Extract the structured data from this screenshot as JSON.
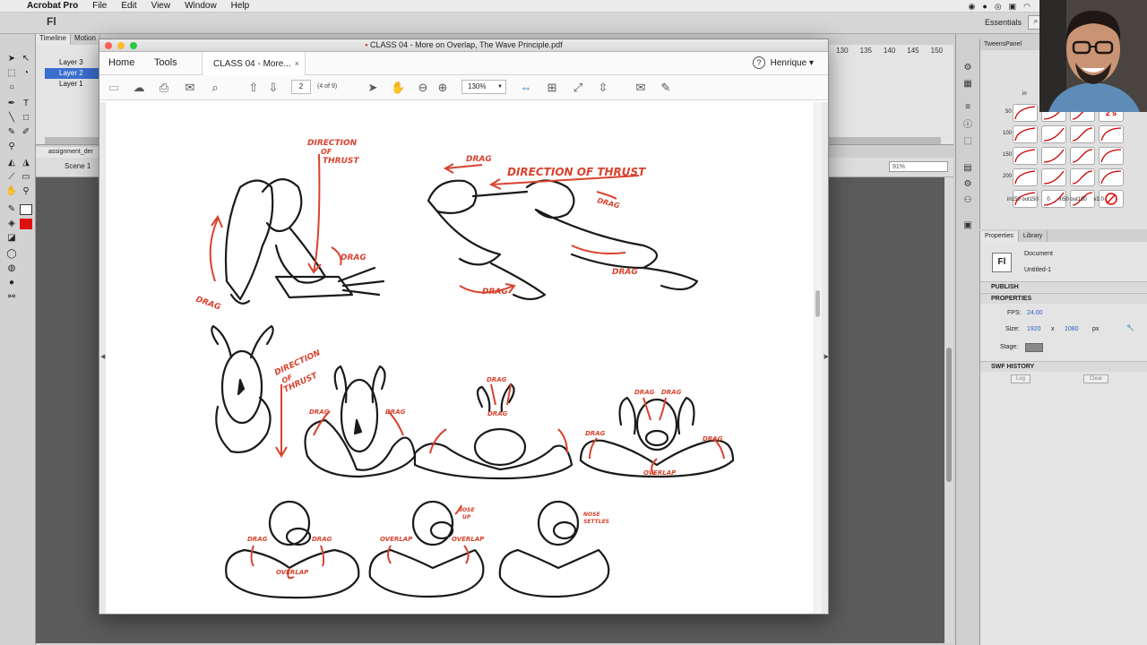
{
  "menubar": {
    "app_name": "Acrobat Pro",
    "items": [
      "File",
      "Edit",
      "View",
      "Window",
      "Help"
    ]
  },
  "animate": {
    "logo": "Fl",
    "workspace": "Essentials",
    "timeline_tabs": [
      "Timeline",
      "Motion"
    ],
    "layers": [
      "Layer 3",
      "Layer 2",
      "Layer 1"
    ],
    "selected_layer": "Layer 2",
    "frame_numbers": [
      "130",
      "135",
      "140",
      "145",
      "150"
    ],
    "doc_tab": "assignment_der",
    "scene": "Scene 1",
    "zoom": "91%"
  },
  "tweens_panel": {
    "title": "TweensPanel",
    "in_label": "in",
    "row_labels": [
      "50",
      "100",
      "150",
      "200"
    ],
    "twos_label": "2's",
    "bottom_labels": [
      "in150",
      "out150",
      "0",
      "in50",
      "out150",
      "v2.0"
    ]
  },
  "properties": {
    "tabs": [
      "Properties",
      "Library"
    ],
    "badge": "Fl",
    "doc_label": "Document",
    "doc_name": "Untitled-1",
    "publish": "PUBLISH",
    "properties_head": "PROPERTIES",
    "fps_label": "FPS:",
    "fps_value": "24.00",
    "size_label": "Size:",
    "width": "1920",
    "x": "x",
    "height": "1080",
    "unit": "px",
    "stage_label": "Stage:",
    "swf_history": "SWF HISTORY",
    "log_btn": "Log",
    "clear_btn": "Clear"
  },
  "acrobat": {
    "window_title": "CLASS 04 - More on Overlap, The Wave Principle.pdf",
    "nav_home": "Home",
    "nav_tools": "Tools",
    "tab_label": "CLASS 04 - More...",
    "tab_close": "×",
    "help": "?",
    "user": "Henrique",
    "page_current": "2",
    "page_count": "(4 of 9)",
    "zoom": "130%"
  },
  "sketch_labels": {
    "direction_of_thrust_1": [
      "DIRECTION",
      "OF",
      "THRUST"
    ],
    "drag": "DRAG",
    "direction_of_thrust_2": "DIRECTION OF THRUST",
    "direction_of_thrust_3": [
      "DIRECTION",
      "OF",
      "THRUST"
    ],
    "overlap": "OVERLAP",
    "nose_up": [
      "NOSE",
      "UP"
    ],
    "nose_settles": [
      "NOSE",
      "SETTLES"
    ]
  },
  "colors": {
    "accent_red": "#d8432e",
    "acrobat_blue": "#2775d4",
    "selected_layer": "#3a6fd0"
  },
  "icons": [
    "apple-icon",
    "save-icon",
    "upload-icon",
    "print-icon",
    "mail-icon",
    "search-icon",
    "page-up-icon",
    "page-down-icon",
    "select-arrow-icon",
    "hand-icon",
    "zoom-out-icon",
    "zoom-in-icon",
    "fit-width-icon",
    "fit-page-icon",
    "full-screen-icon",
    "scroll-mode-icon",
    "comment-icon",
    "pen-icon",
    "help-icon"
  ]
}
